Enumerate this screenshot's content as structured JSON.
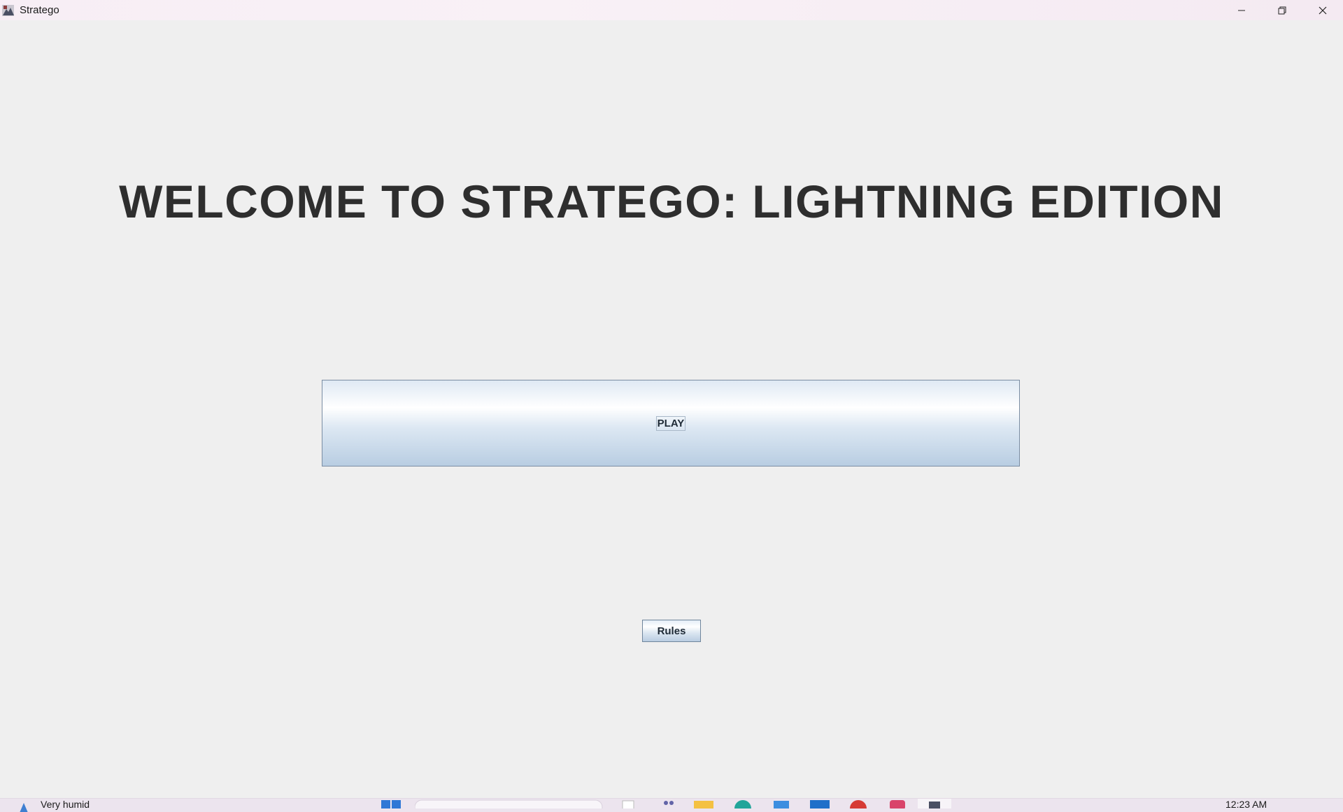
{
  "window": {
    "title": "Stratego"
  },
  "main": {
    "headline": "WELCOME TO STRATEGO: LIGHTNING EDITION",
    "play_label": "PLAY",
    "rules_label": "Rules"
  },
  "taskbar": {
    "weather_text": "Very humid",
    "clock_text": "12:23 AM"
  },
  "colors": {
    "background": "#efefef",
    "headline": "#2e2e2e",
    "button_border": "#7a8da3",
    "button_gradient_bottom": "#b8cde2"
  }
}
